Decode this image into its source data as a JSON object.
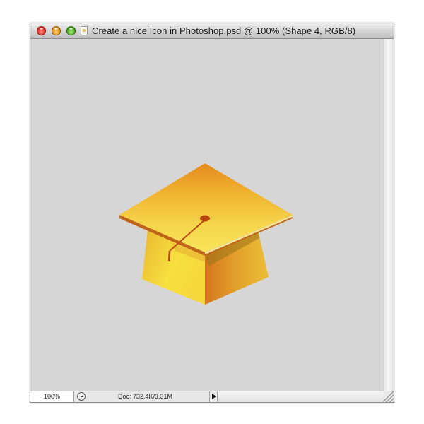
{
  "window": {
    "title": "Create a nice Icon in Photoshop.psd @ 100% (Shape 4, RGB/8)"
  },
  "titlebar": {
    "buttons": [
      "close",
      "minimize",
      "zoom"
    ],
    "document_icon": "psd-document-icon"
  },
  "canvas": {
    "background": "#d6d6d6",
    "artwork": "graduation-cap-icon",
    "colors": {
      "board_top_light": "#f7dd55",
      "board_top_dark": "#e58e22",
      "board_edge": "#c0641a",
      "tassel": "#b9480e",
      "base_light": "#f8e23d",
      "base_dark": "#d88621"
    }
  },
  "statusbar": {
    "zoom": "100%",
    "doc_info": "Doc: 732.4K/3.31M"
  }
}
